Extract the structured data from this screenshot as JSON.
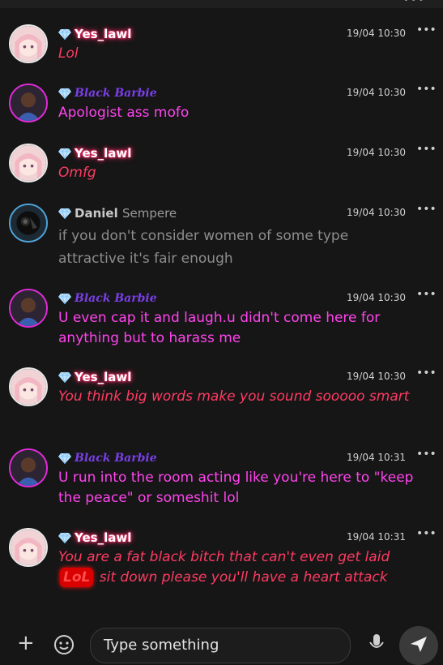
{
  "chat": {
    "messages": [
      {
        "author": "Yes_lawl",
        "time": "19/04 10:30",
        "text": "Lol"
      },
      {
        "author": "Black Barbie",
        "time": "19/04 10:30",
        "text": "Apologist ass mofo"
      },
      {
        "author": "Yes_lawl",
        "time": "19/04 10:30",
        "text": "Omfg"
      },
      {
        "author_first": "Daniel",
        "author_last": "Sempere",
        "time": "19/04 10:30",
        "text": "if you don't consider women of some type attractive it's fair enough"
      },
      {
        "author": "Black Barbie",
        "time": "19/04 10:30",
        "text": "U even cap it and laugh.u didn't come here for anything but to harass me"
      },
      {
        "author": "Yes_lawl",
        "time": "19/04 10:30",
        "text": "You think big words make you sound sooooo smart"
      },
      {
        "author": "Black Barbie",
        "time": "19/04 10:31",
        "text": "U run into the room acting like you're here to \"keep the peace\" or someshit lol"
      },
      {
        "author": "Yes_lawl",
        "time": "19/04 10:31",
        "text_before": "You are a fat black bitch that can't even get laid",
        "badge": "LoL",
        "text_after": "sit down please you'll have a heart attack"
      }
    ],
    "more_glyph": "•••"
  },
  "composer": {
    "placeholder": "Type something"
  },
  "colors": {
    "background": "#161616",
    "yes_lawl_text": "#ff3b63",
    "black_barbie_text": "#ff44ee",
    "black_barbie_name": "#7a3fe8",
    "daniel_text": "#8d8d8d"
  },
  "icons": [
    "diamond-badge-icon",
    "more-icon",
    "plus-icon",
    "emoji-icon",
    "microphone-icon",
    "send-icon"
  ]
}
